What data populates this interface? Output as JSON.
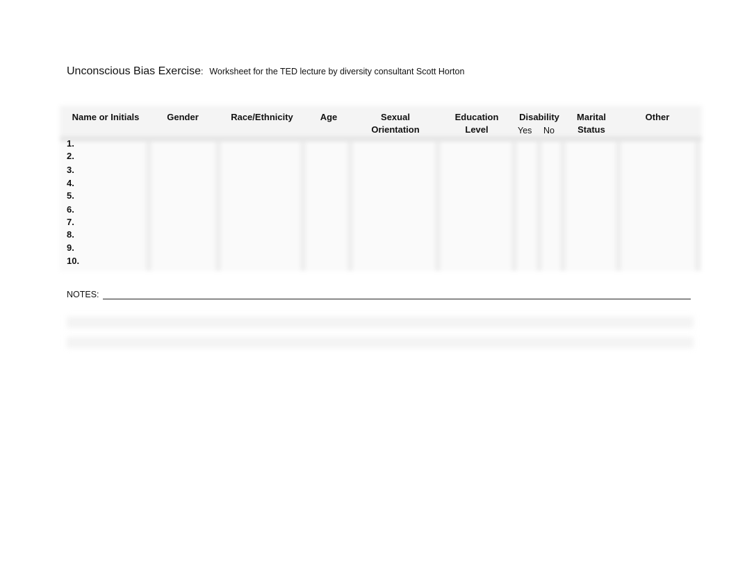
{
  "title": {
    "main": "Unconscious Bias Exercise",
    "colon": ":",
    "subtitle": "Worksheet for the TED lecture by diversity consultant Scott Horton"
  },
  "table": {
    "columns": [
      {
        "line1": "Name or Initials",
        "line2": ""
      },
      {
        "line1": "Gender",
        "line2": ""
      },
      {
        "line1": "Race/Ethnicity",
        "line2": ""
      },
      {
        "line1": "Age",
        "line2": ""
      },
      {
        "line1": "Sexual",
        "line2": "Orientation"
      },
      {
        "line1": "Education",
        "line2": "Level"
      },
      {
        "line1": "Disability",
        "line2": ""
      },
      {
        "line1": "Marital",
        "line2": "Status"
      },
      {
        "line1": "Other",
        "line2": ""
      }
    ],
    "disability_options": [
      "Yes",
      "No"
    ],
    "rows": [
      "1.",
      "2.",
      "3.",
      "4.",
      "5.",
      "6.",
      "7.",
      "8.",
      "9.",
      "10."
    ]
  },
  "notes": {
    "label": "NOTES:"
  }
}
